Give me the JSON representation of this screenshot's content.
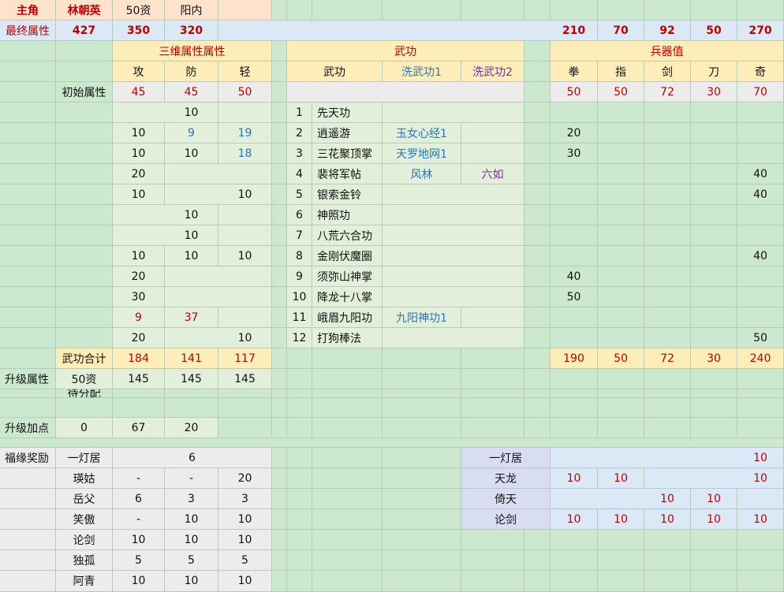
{
  "colors": {
    "red": "#c00000",
    "blue": "#2e75b6",
    "purple": "#7030a0"
  },
  "rows": [
    [
      {
        "t": "主角",
        "cls": "t-red b"
      },
      {
        "t": "林朝英",
        "cls": "t-red b"
      },
      {
        "t": "50资"
      },
      {
        "t": "阳内"
      }
    ],
    [
      {
        "t": "最终属性",
        "cls": "t-red"
      },
      {
        "t": "427",
        "cls": "t-red b"
      },
      {
        "t": "350",
        "cls": "t-red b"
      },
      {
        "t": "320",
        "cls": "t-red b"
      },
      {
        "t": "210",
        "cls": "t-red b"
      },
      {
        "t": "70",
        "cls": "t-red b"
      },
      {
        "t": "92",
        "cls": "t-red b"
      },
      {
        "t": "50",
        "cls": "t-red b"
      },
      {
        "t": "270",
        "cls": "t-red b"
      }
    ],
    [
      {
        "t": "三维属性属性",
        "cls": "t-red"
      },
      {
        "t": "武功",
        "cls": "t-red"
      },
      {
        "t": "兵器值",
        "cls": "t-red"
      }
    ],
    [
      {
        "t": "攻"
      },
      {
        "t": "防"
      },
      {
        "t": "轻"
      },
      {
        "t": "武功"
      },
      {
        "t": "洗武功1",
        "cls": "t-blue"
      },
      {
        "t": "洗武功2",
        "cls": "t-purple"
      },
      {
        "t": "拳"
      },
      {
        "t": "指"
      },
      {
        "t": "剑"
      },
      {
        "t": "刀"
      },
      {
        "t": "奇"
      }
    ],
    [
      {
        "t": "初始属性"
      },
      {
        "t": "45",
        "cls": "t-red"
      },
      {
        "t": "45",
        "cls": "t-red"
      },
      {
        "t": "50",
        "cls": "t-red"
      },
      {
        "t": "50",
        "cls": "t-red"
      },
      {
        "t": "50",
        "cls": "t-red"
      },
      {
        "t": "72",
        "cls": "t-red"
      },
      {
        "t": "30",
        "cls": "t-red"
      },
      {
        "t": "70",
        "cls": "t-red"
      }
    ],
    [
      {
        "t": "10"
      },
      {
        "t": "1"
      },
      {
        "t": "先天功"
      }
    ],
    [
      {
        "t": "10"
      },
      {
        "t": "9",
        "cls": "t-blue"
      },
      {
        "t": "19",
        "cls": "t-blue"
      },
      {
        "t": "2"
      },
      {
        "t": "逍遥游"
      },
      {
        "t": "玉女心经1",
        "cls": "t-blue"
      },
      {
        "t": "20"
      }
    ],
    [
      {
        "t": "10"
      },
      {
        "t": "10"
      },
      {
        "t": "18",
        "cls": "t-blue"
      },
      {
        "t": "3"
      },
      {
        "t": "三花聚顶掌"
      },
      {
        "t": "天罗地网1",
        "cls": "t-blue"
      },
      {
        "t": "30"
      }
    ],
    [
      {
        "t": "20"
      },
      {
        "t": "4"
      },
      {
        "t": "裴将军帖"
      },
      {
        "t": "风林",
        "cls": "t-blue"
      },
      {
        "t": "六如",
        "cls": "t-purple"
      },
      {
        "t": "40"
      }
    ],
    [
      {
        "t": "10"
      },
      {
        "t": "10"
      },
      {
        "t": "5"
      },
      {
        "t": "银索金铃"
      },
      {
        "t": "40"
      }
    ],
    [
      {
        "t": "10"
      },
      {
        "t": "6"
      },
      {
        "t": "神照功"
      }
    ],
    [
      {
        "t": "10"
      },
      {
        "t": "7"
      },
      {
        "t": "八荒六合功"
      }
    ],
    [
      {
        "t": "10"
      },
      {
        "t": "10"
      },
      {
        "t": "10"
      },
      {
        "t": "8"
      },
      {
        "t": "金刚伏魔圈"
      },
      {
        "t": "40"
      }
    ],
    [
      {
        "t": "20"
      },
      {
        "t": "9"
      },
      {
        "t": "须弥山神掌"
      },
      {
        "t": "40"
      }
    ],
    [
      {
        "t": "30"
      },
      {
        "t": "10"
      },
      {
        "t": "降龙十八掌"
      },
      {
        "t": "50"
      }
    ],
    [
      {
        "t": "9",
        "cls": "t-red"
      },
      {
        "t": "37",
        "cls": "t-red"
      },
      {
        "t": "11"
      },
      {
        "t": "峨眉九阳功"
      },
      {
        "t": "九阳神功1",
        "cls": "t-blue"
      }
    ],
    [
      {
        "t": "20"
      },
      {
        "t": "10"
      },
      {
        "t": "12"
      },
      {
        "t": "打狗棒法"
      },
      {
        "t": "50"
      }
    ],
    [
      {
        "t": "武功合计"
      },
      {
        "t": "184",
        "cls": "t-red"
      },
      {
        "t": "141",
        "cls": "t-red"
      },
      {
        "t": "117",
        "cls": "t-red"
      },
      {
        "t": "190",
        "cls": "t-red"
      },
      {
        "t": "50",
        "cls": "t-red"
      },
      {
        "t": "72",
        "cls": "t-red"
      },
      {
        "t": "30",
        "cls": "t-red"
      },
      {
        "t": "240",
        "cls": "t-red"
      }
    ],
    [
      {
        "t": "升级属性"
      },
      {
        "t": "50资"
      },
      {
        "t": "145"
      },
      {
        "t": "145"
      },
      {
        "t": "145"
      }
    ],
    [
      {
        "t": "待分配"
      }
    ],
    [
      {
        "t": "升级加点"
      },
      {
        "t": "0"
      },
      {
        "t": "67"
      },
      {
        "t": "20"
      }
    ],
    [
      {
        "t": "福缘奖励"
      },
      {
        "t": "一灯居"
      },
      {
        "t": "6"
      },
      {
        "t": "一灯居"
      },
      {
        "t": "10",
        "cls": "t-red"
      }
    ],
    [
      {
        "t": "瑛姑"
      },
      {
        "t": "-"
      },
      {
        "t": "-"
      },
      {
        "t": "20"
      },
      {
        "t": "天龙"
      },
      {
        "t": "10",
        "cls": "t-red"
      },
      {
        "t": "10",
        "cls": "t-red"
      },
      {
        "t": "10",
        "cls": "t-red"
      }
    ],
    [
      {
        "t": "岳父"
      },
      {
        "t": "6"
      },
      {
        "t": "3"
      },
      {
        "t": "3"
      },
      {
        "t": "倚天"
      },
      {
        "t": "10",
        "cls": "t-red"
      },
      {
        "t": "10",
        "cls": "t-red"
      }
    ],
    [
      {
        "t": "笑傲"
      },
      {
        "t": "-"
      },
      {
        "t": "10"
      },
      {
        "t": "10"
      },
      {
        "t": "论剑"
      },
      {
        "t": "10",
        "cls": "t-red"
      },
      {
        "t": "10",
        "cls": "t-red"
      },
      {
        "t": "10",
        "cls": "t-red"
      },
      {
        "t": "10",
        "cls": "t-red"
      },
      {
        "t": "10",
        "cls": "t-red"
      }
    ],
    [
      {
        "t": "论剑"
      },
      {
        "t": "10"
      },
      {
        "t": "10"
      },
      {
        "t": "10"
      }
    ],
    [
      {
        "t": "独孤"
      },
      {
        "t": "5"
      },
      {
        "t": "5"
      },
      {
        "t": "5"
      }
    ],
    [
      {
        "t": "阿青"
      },
      {
        "t": "10"
      },
      {
        "t": "10"
      },
      {
        "t": "10"
      }
    ]
  ]
}
